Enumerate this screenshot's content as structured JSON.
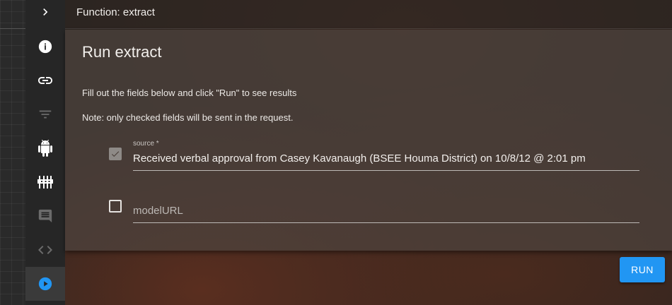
{
  "header": {
    "title": "Function: extract"
  },
  "sidebar": {
    "items": [
      {
        "icon": "chevron-right-icon",
        "active": false
      },
      {
        "icon": "info-icon",
        "active": false
      },
      {
        "icon": "link-icon",
        "active": false
      },
      {
        "icon": "filter-icon",
        "active": false,
        "disabled": true
      },
      {
        "icon": "android-icon",
        "active": false
      },
      {
        "icon": "sliders-icon",
        "active": false
      },
      {
        "icon": "comment-icon",
        "active": false,
        "disabled": true
      },
      {
        "icon": "code-icon",
        "active": false,
        "disabled": true
      },
      {
        "icon": "play-circle-icon",
        "active": true,
        "color": "#2196f3"
      }
    ]
  },
  "card": {
    "title": "Run extract",
    "instruction": "Fill out the fields below and click \"Run\" to see results",
    "note": "Note: only checked fields will be sent in the request."
  },
  "fields": [
    {
      "label": "source *",
      "value": "Received verbal approval from Casey Kavanaugh (BSEE Houma District) on 10/8/12 @ 2:01 pm",
      "checked": true
    },
    {
      "label": "",
      "placeholder": "modelURL",
      "value": "",
      "checked": false
    }
  ],
  "run_button": {
    "label": "RUN"
  },
  "colors": {
    "accent": "#2196f3",
    "card": "#4e443e",
    "sidebar": "#262626"
  }
}
